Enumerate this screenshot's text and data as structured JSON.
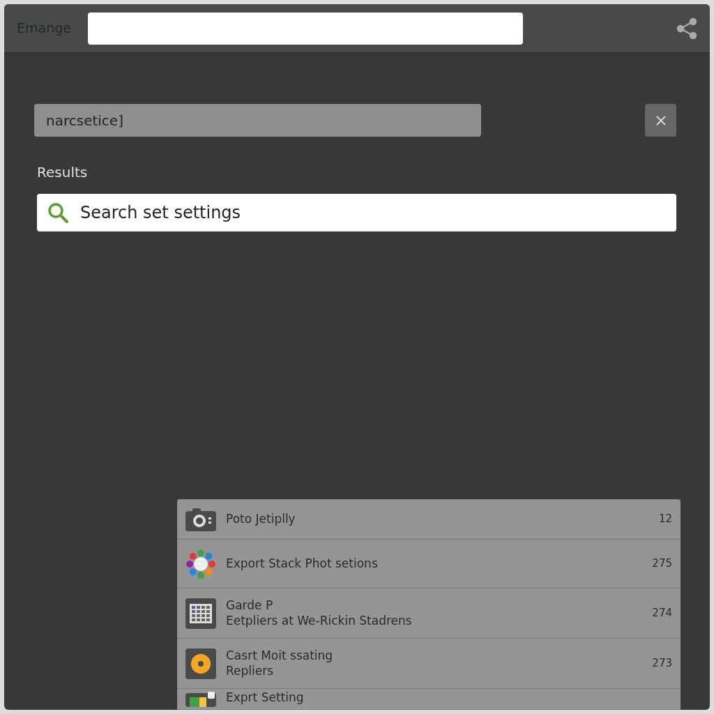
{
  "header": {
    "title": "Emange"
  },
  "query": {
    "value": "narcsetice]"
  },
  "results_label": "Results",
  "settings_search": {
    "placeholder": "Search set settings"
  },
  "results": [
    {
      "title": "Poto Jetiplly",
      "count": "12"
    },
    {
      "title": "Export Stack Phot setions",
      "count": "275"
    },
    {
      "title": "Garde P",
      "subtitle": "Eetpliers at We-Rickin Stadrens",
      "count": "274"
    },
    {
      "title": "Casrt Moit ssating",
      "subtitle": "Repliers",
      "count": "273"
    },
    {
      "title": "Exprt Setting"
    }
  ]
}
